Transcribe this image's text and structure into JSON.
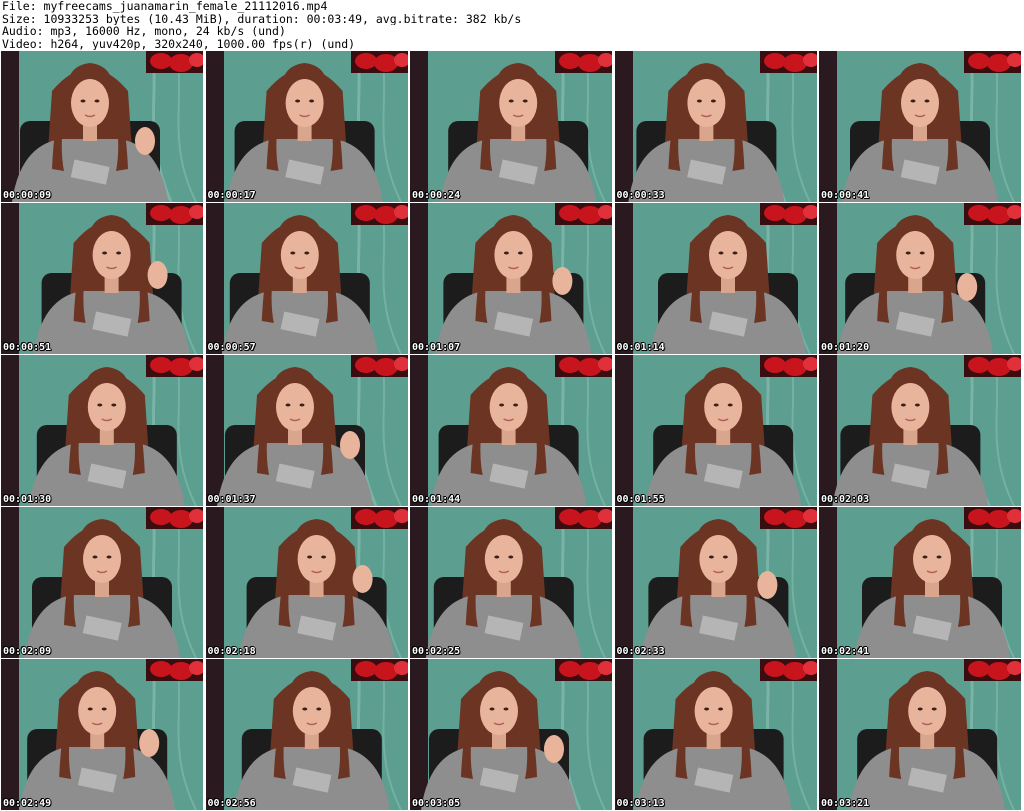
{
  "header": {
    "file": "File: myfreecams_juanamarin_female_21112016.mp4",
    "size": "Size: 10933253 bytes (10.43 MiB), duration: 00:03:49, avg.bitrate: 382 kb/s",
    "audio": "Audio: mp3, 16000 Hz, mono, 24 kb/s (und)",
    "video": "Video: h264, yuv420p, 320x240, 1000.00 fps(r) (und)"
  },
  "colors": {
    "wall": "#5c9e8f",
    "curtain": "#2a1a20",
    "chair": "#1c1c1c",
    "shirt": "#8e8e8e",
    "hair": "#6b3423",
    "skin": "#e8b59c",
    "flower": "#c8141c"
  },
  "thumbnails": [
    {
      "time": "00:00:09",
      "icon": "video-frame-icon"
    },
    {
      "time": "00:00:17",
      "icon": "video-frame-icon"
    },
    {
      "time": "00:00:24",
      "icon": "video-frame-icon"
    },
    {
      "time": "00:00:33",
      "icon": "video-frame-icon"
    },
    {
      "time": "00:00:41",
      "icon": "video-frame-icon"
    },
    {
      "time": "00:00:51",
      "icon": "video-frame-icon"
    },
    {
      "time": "00:00:57",
      "icon": "video-frame-icon"
    },
    {
      "time": "00:01:07",
      "icon": "video-frame-icon"
    },
    {
      "time": "00:01:14",
      "icon": "video-frame-icon"
    },
    {
      "time": "00:01:20",
      "icon": "video-frame-icon"
    },
    {
      "time": "00:01:30",
      "icon": "video-frame-icon"
    },
    {
      "time": "00:01:37",
      "icon": "video-frame-icon"
    },
    {
      "time": "00:01:44",
      "icon": "video-frame-icon"
    },
    {
      "time": "00:01:55",
      "icon": "video-frame-icon"
    },
    {
      "time": "00:02:03",
      "icon": "video-frame-icon"
    },
    {
      "time": "00:02:09",
      "icon": "video-frame-icon"
    },
    {
      "time": "00:02:18",
      "icon": "video-frame-icon"
    },
    {
      "time": "00:02:25",
      "icon": "video-frame-icon"
    },
    {
      "time": "00:02:33",
      "icon": "video-frame-icon"
    },
    {
      "time": "00:02:41",
      "icon": "video-frame-icon"
    },
    {
      "time": "00:02:49",
      "icon": "video-frame-icon"
    },
    {
      "time": "00:02:56",
      "icon": "video-frame-icon"
    },
    {
      "time": "00:03:05",
      "icon": "video-frame-icon"
    },
    {
      "time": "00:03:13",
      "icon": "video-frame-icon"
    },
    {
      "time": "00:03:21",
      "icon": "video-frame-icon"
    }
  ]
}
